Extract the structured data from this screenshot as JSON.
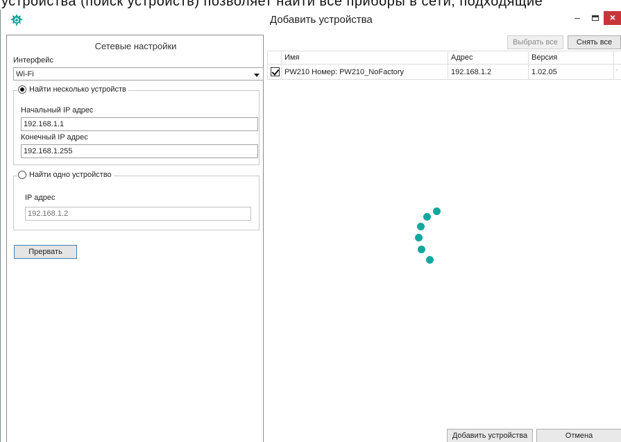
{
  "background_text": "устройства (поиск устройств) позволяет найти все приборы в сети, подходящие",
  "window": {
    "title": "Добавить устройства",
    "minimize_label": "–",
    "close_label": "×"
  },
  "left_panel": {
    "heading": "Сетевые настройки",
    "interface_label": "Интерфейс",
    "interface_value": "Wi-Fi",
    "multi_search": {
      "label": "Найти несколько устройств",
      "selected": true,
      "start_ip_label": "Начальный IP адрес",
      "start_ip_value": "192.168.1.1",
      "end_ip_label": "Конечный IP адрес",
      "end_ip_value": "192.168.1.255"
    },
    "single_search": {
      "label": "Найти одно устройство",
      "selected": false,
      "ip_label": "IP адрес",
      "ip_value": "192.168.1.2"
    },
    "stop_button": "Прервать"
  },
  "right_panel": {
    "select_all_button": "Выбрать все",
    "deselect_all_button": "Снять все",
    "table": {
      "columns": [
        "Имя",
        "Адрес",
        "Версия"
      ],
      "rows": [
        {
          "checked": true,
          "name": "PW210 Номер: PW210_NoFactory",
          "address": "192.168.1.2",
          "version": "1.02.05"
        }
      ]
    },
    "add_button": "Добавить устройства",
    "cancel_button": "Отмена"
  },
  "colors": {
    "accent": "#13a89e",
    "close_button": "#c7353a",
    "focus_border": "#3c7fb1"
  },
  "icons": [
    "app-logo-icon",
    "loading-spinner-icon",
    "dropdown-arrow-icon",
    "checkbox-checked-icon"
  ]
}
